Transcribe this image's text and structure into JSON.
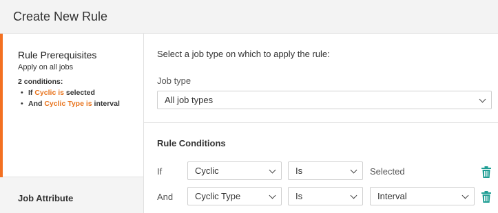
{
  "header": {
    "title": "Create New Rule"
  },
  "sidebar": {
    "steps": [
      {
        "title": "Rule Prerequisites",
        "subtitle": "Apply on all jobs",
        "conditions_count": "2 conditions:",
        "conditions": [
          {
            "prefix": "If",
            "highlight": "Cyclic is",
            "suffix": "selected"
          },
          {
            "prefix": "And",
            "highlight": "Cyclic Type is",
            "suffix": "interval"
          }
        ]
      },
      {
        "title": "Job Attribute"
      }
    ]
  },
  "main": {
    "intro": "Select a job type on which to apply the rule:",
    "job_type": {
      "label": "Job type",
      "value": "All job types"
    },
    "conditions_title": "Rule Conditions",
    "conditions": [
      {
        "connector": "If",
        "field": "Cyclic",
        "operator": "Is",
        "value": "Selected"
      },
      {
        "connector": "And",
        "field": "Cyclic Type",
        "operator": "Is",
        "value": "Interval"
      }
    ]
  },
  "colors": {
    "accent": "#f37021",
    "highlight_text": "#e8731c",
    "delete_icon": "#1f9e94"
  },
  "icons": {
    "select_arrow": "chevron-down-icon",
    "delete": "trash-icon"
  }
}
